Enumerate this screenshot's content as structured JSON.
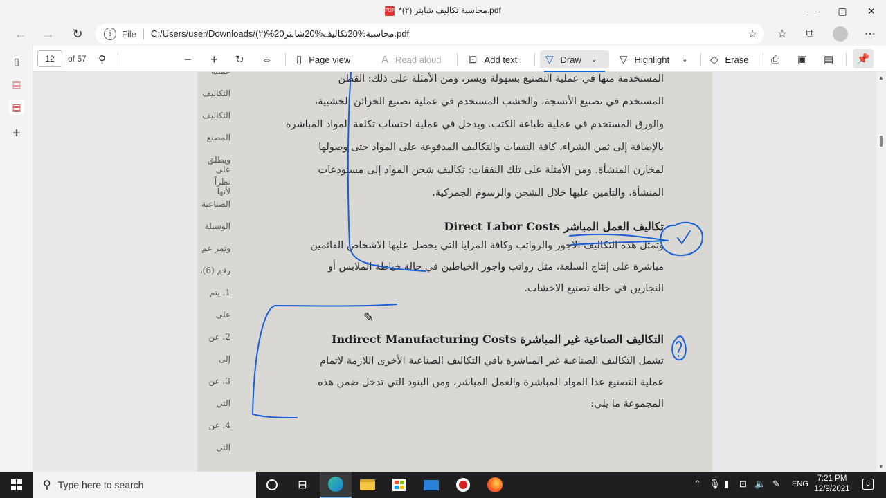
{
  "window": {
    "title": "*محاسبة تكاليف شابتر (٢).pdf",
    "pdf_badge": "PDF",
    "minimize_glyph": "—",
    "maximize_glyph": "▢",
    "close_glyph": "✕"
  },
  "nav": {
    "back_glyph": "←",
    "forward_glyph": "→",
    "refresh_glyph": "↻",
    "file_label": "File",
    "url": "C:/Users/user/Downloads/(٢)%20محاسبة%20تكاليف%20شابتر.pdf"
  },
  "pdf_toolbar": {
    "page_number": "12",
    "page_count": "of 57",
    "page_view_label": "Page view",
    "read_aloud_label": "Read aloud",
    "add_text_label": "Add text",
    "draw_label": "Draw",
    "highlight_label": "Highlight",
    "erase_label": "Erase"
  },
  "document": {
    "left_column_fragments": [
      "عملية",
      "التكاليف",
      "التكاليف",
      "المصنع",
      "ويطلق على",
      "نظراً لأنها",
      "الصناعية",
      "الوسيلة",
      "وتمر عم",
      "رقم (6)،",
      "1. يتم",
      "على",
      "2. عن",
      "إلى",
      "3. عن",
      "التي",
      "4. عن",
      "التي"
    ],
    "lines_top": [
      "المستخدمة منها في عملية التصنيع بسهولة ويسر، ومن الأمثلة على ذلك: القطن",
      "المستخدم في تصنيع الأنسجة، والخشب المستخدم في عملية تصنيع الخزائن الخشبية،",
      "والورق المستخدم في عملية طباعة الكتب. ويدخل في عملية احتساب تكلفة المواد المباشرة",
      "بالإضافة إلى ثمن الشراء، كافة النفقات والتكاليف المدفوعة على المواد حتى وصولها",
      "لمخازن المنشأة. ومن الأمثلة على تلك النفقات: تكاليف شحن المواد إلى مستودعات",
      "المنشأة، والتامين عليها خلال الشحن والرسوم الجمركية."
    ],
    "heading_direct_labor": "Direct Labor Costs تكاليف العمل المباشر",
    "lines_labor": [
      "وتمثل هذه التكاليف الاجور والرواتب وكافة المزايا التي يحصل عليها الاشخاص القائمين",
      "مباشرة على إنتاج السلعة، مثل رواتب واجور الخياطين في حالة خياطة الملابس أو",
      "النجارين في حالة تصنيع الاخشاب."
    ],
    "heading_indirect": "Indirect Manufacturing Costs التكاليف الصناعية غير المباشرة",
    "lines_indirect": [
      "تشمل التكاليف الصناعية غير المباشرة باقي التكاليف الصناعية الأخرى اللازمة لاتمام",
      "عملية التصنيع عدا المواد المباشرة والعمل المباشر، ومن البنود التي تدخل ضمن هذه",
      "المجموعة ما يلي:"
    ],
    "ink_color": "#1a5fd6"
  },
  "taskbar": {
    "search_placeholder": "Type here to search",
    "language": "ENG",
    "time": "7:21 PM",
    "date": "12/9/2021",
    "notification_count": "3"
  }
}
